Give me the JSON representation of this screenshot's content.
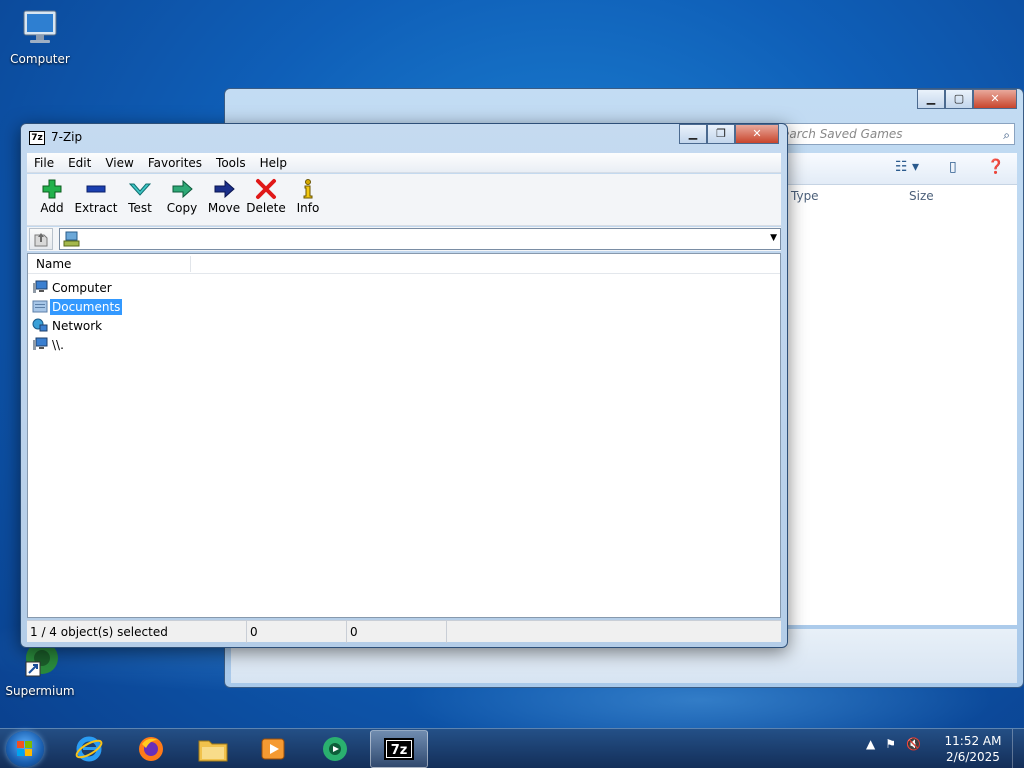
{
  "desktop": {
    "icons": [
      {
        "label": "Computer"
      },
      {
        "label": "Supermium"
      }
    ]
  },
  "background_window": {
    "search_placeholder": "earch Saved Games",
    "columns": [
      "Type",
      "Size"
    ]
  },
  "sevenzip": {
    "title": "7-Zip",
    "app_icon_text": "7z",
    "menu": [
      "File",
      "Edit",
      "View",
      "Favorites",
      "Tools",
      "Help"
    ],
    "toolbar": [
      {
        "label": "Add",
        "icon": "add-icon"
      },
      {
        "label": "Extract",
        "icon": "extract-icon"
      },
      {
        "label": "Test",
        "icon": "test-icon"
      },
      {
        "label": "Copy",
        "icon": "copy-icon"
      },
      {
        "label": "Move",
        "icon": "move-icon"
      },
      {
        "label": "Delete",
        "icon": "delete-icon"
      },
      {
        "label": "Info",
        "icon": "info-icon"
      }
    ],
    "address": "",
    "list_header": "Name",
    "items": [
      {
        "label": "Computer",
        "icon": "computer-icon",
        "selected": false
      },
      {
        "label": "Documents",
        "icon": "documents-icon",
        "selected": true
      },
      {
        "label": "Network",
        "icon": "network-icon",
        "selected": false
      },
      {
        "label": "\\\\.",
        "icon": "computer-icon",
        "selected": false
      }
    ],
    "status": {
      "selection": "1 / 4 object(s) selected",
      "size": "0",
      "packed": "0"
    }
  },
  "taskbar": {
    "apps": [
      "internet-explorer-icon",
      "firefox-icon",
      "file-explorer-icon",
      "media-player-icon",
      "media-center-icon",
      "sevenzip-icon"
    ],
    "clock": {
      "time": "11:52 AM",
      "date": "2/6/2025"
    }
  }
}
